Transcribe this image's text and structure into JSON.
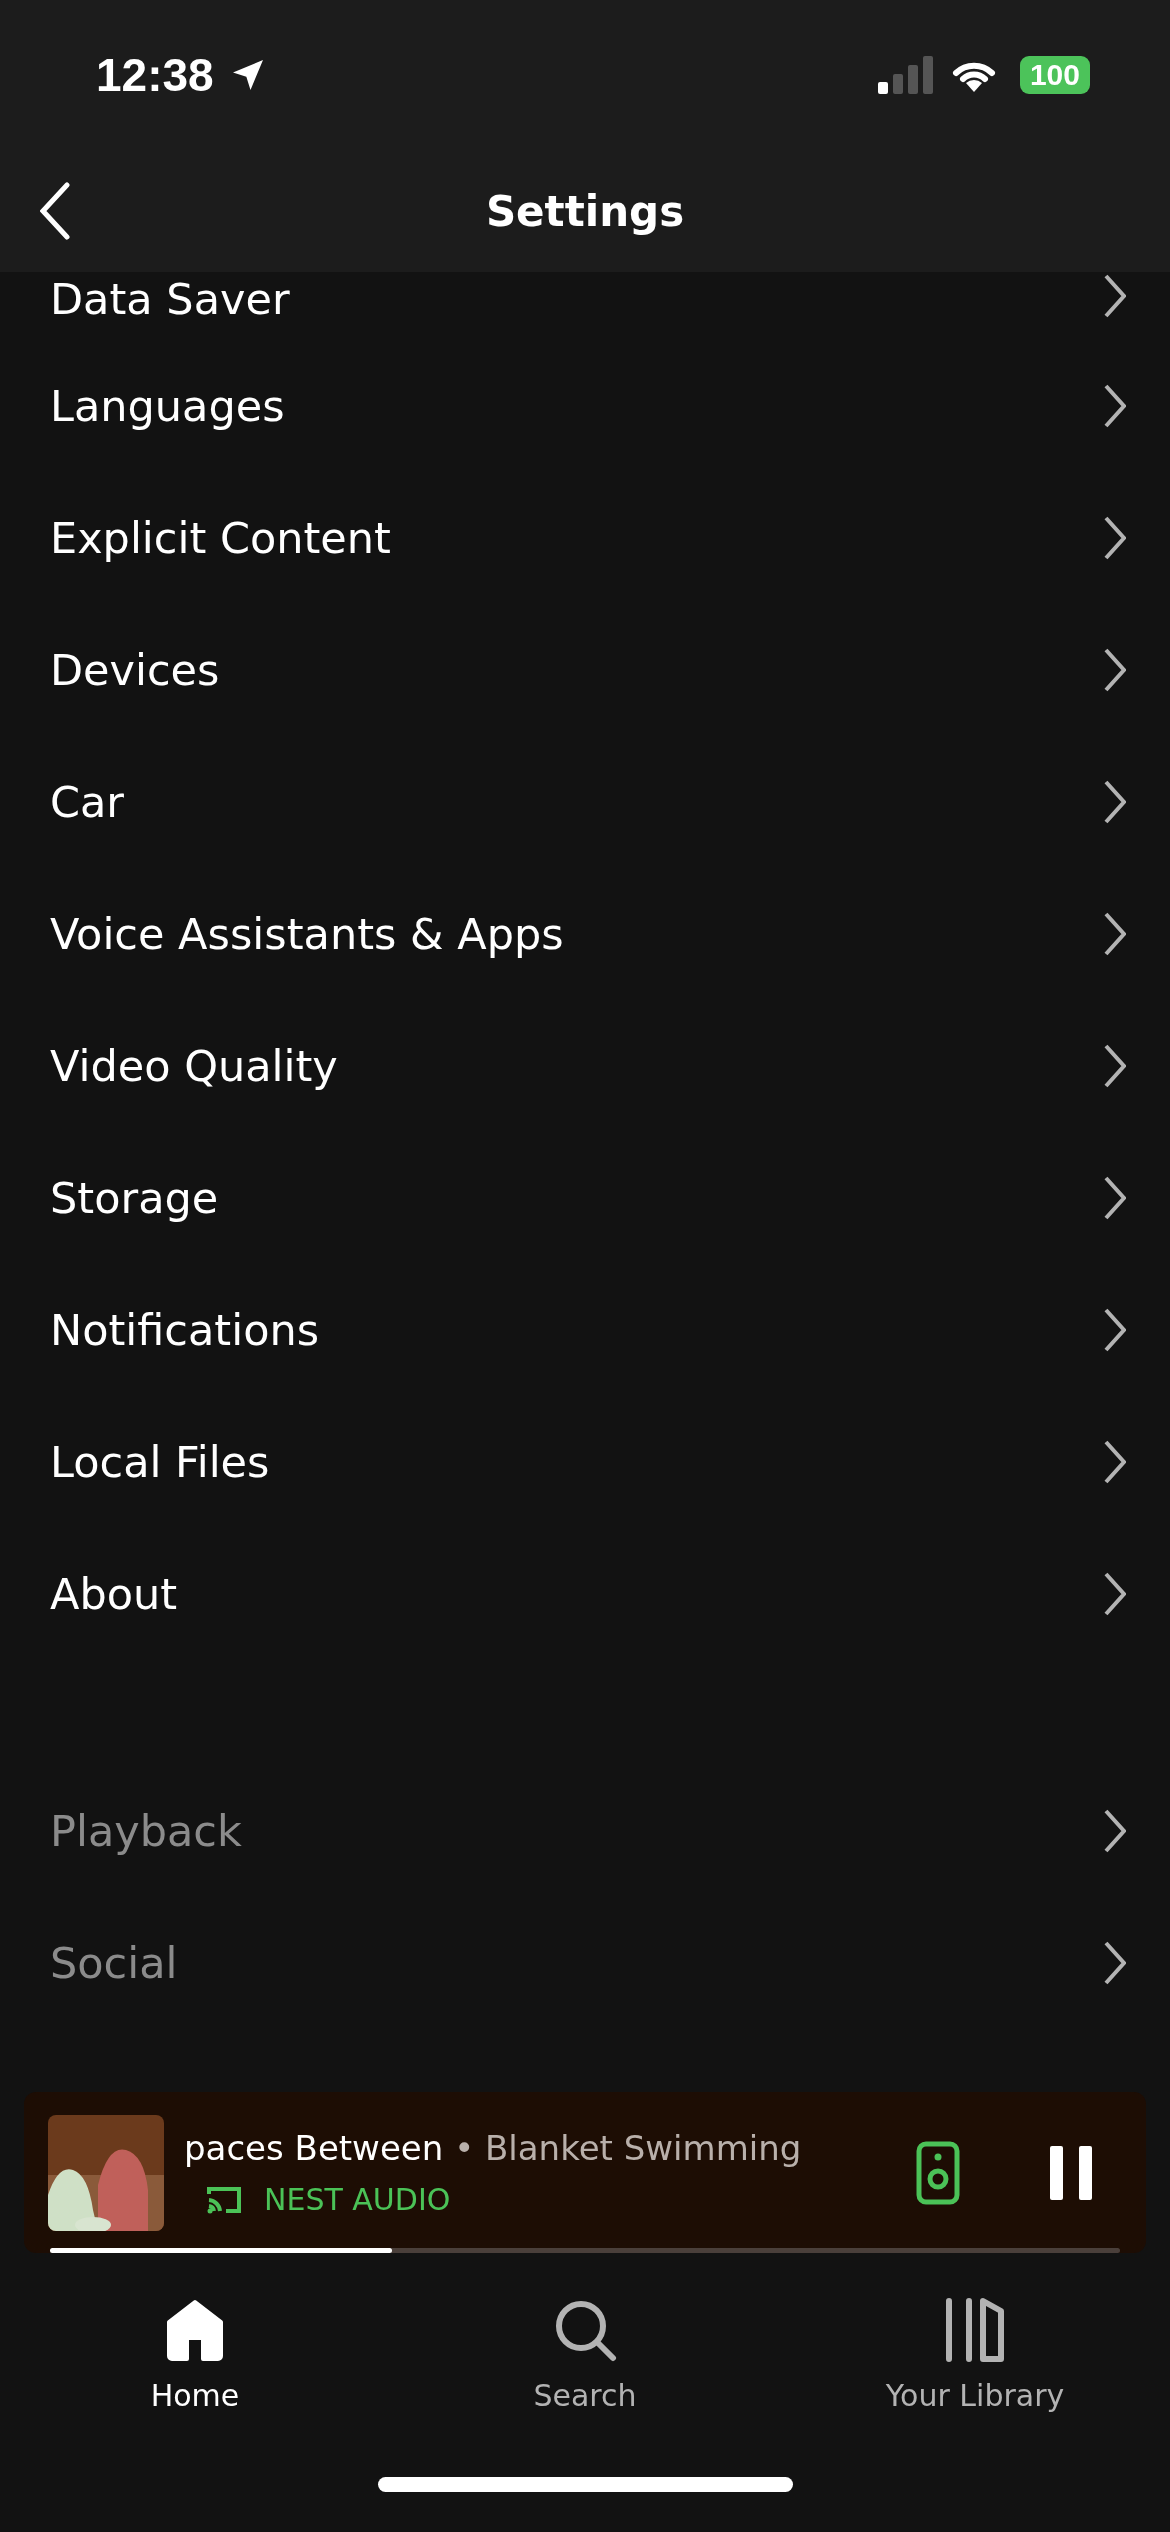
{
  "status_bar": {
    "time": "12:38",
    "battery": "100"
  },
  "header": {
    "title": "Settings"
  },
  "sections": [
    {
      "items": [
        {
          "label": "Data Saver",
          "disabled": false
        },
        {
          "label": "Languages",
          "disabled": false
        },
        {
          "label": "Explicit Content",
          "disabled": false
        },
        {
          "label": "Devices",
          "disabled": false
        },
        {
          "label": "Car",
          "disabled": false
        },
        {
          "label": "Voice Assistants & Apps",
          "disabled": false
        },
        {
          "label": "Video Quality",
          "disabled": false
        },
        {
          "label": "Storage",
          "disabled": false
        },
        {
          "label": "Notifications",
          "disabled": false
        },
        {
          "label": "Local Files",
          "disabled": false
        },
        {
          "label": "About",
          "disabled": false
        }
      ]
    },
    {
      "items": [
        {
          "label": "Playback",
          "disabled": true
        },
        {
          "label": "Social",
          "disabled": true
        }
      ]
    }
  ],
  "now_playing": {
    "title": "paces Between",
    "separator": "•",
    "artist": "Blanket Swimming",
    "device": "NEST AUDIO",
    "playing": true,
    "level": 0.32
  },
  "tabs": [
    {
      "label": "Home",
      "kind": "home",
      "selected": true
    },
    {
      "label": "Search",
      "kind": "search",
      "selected": false
    },
    {
      "label": "Your Library",
      "kind": "library",
      "selected": false
    }
  ]
}
